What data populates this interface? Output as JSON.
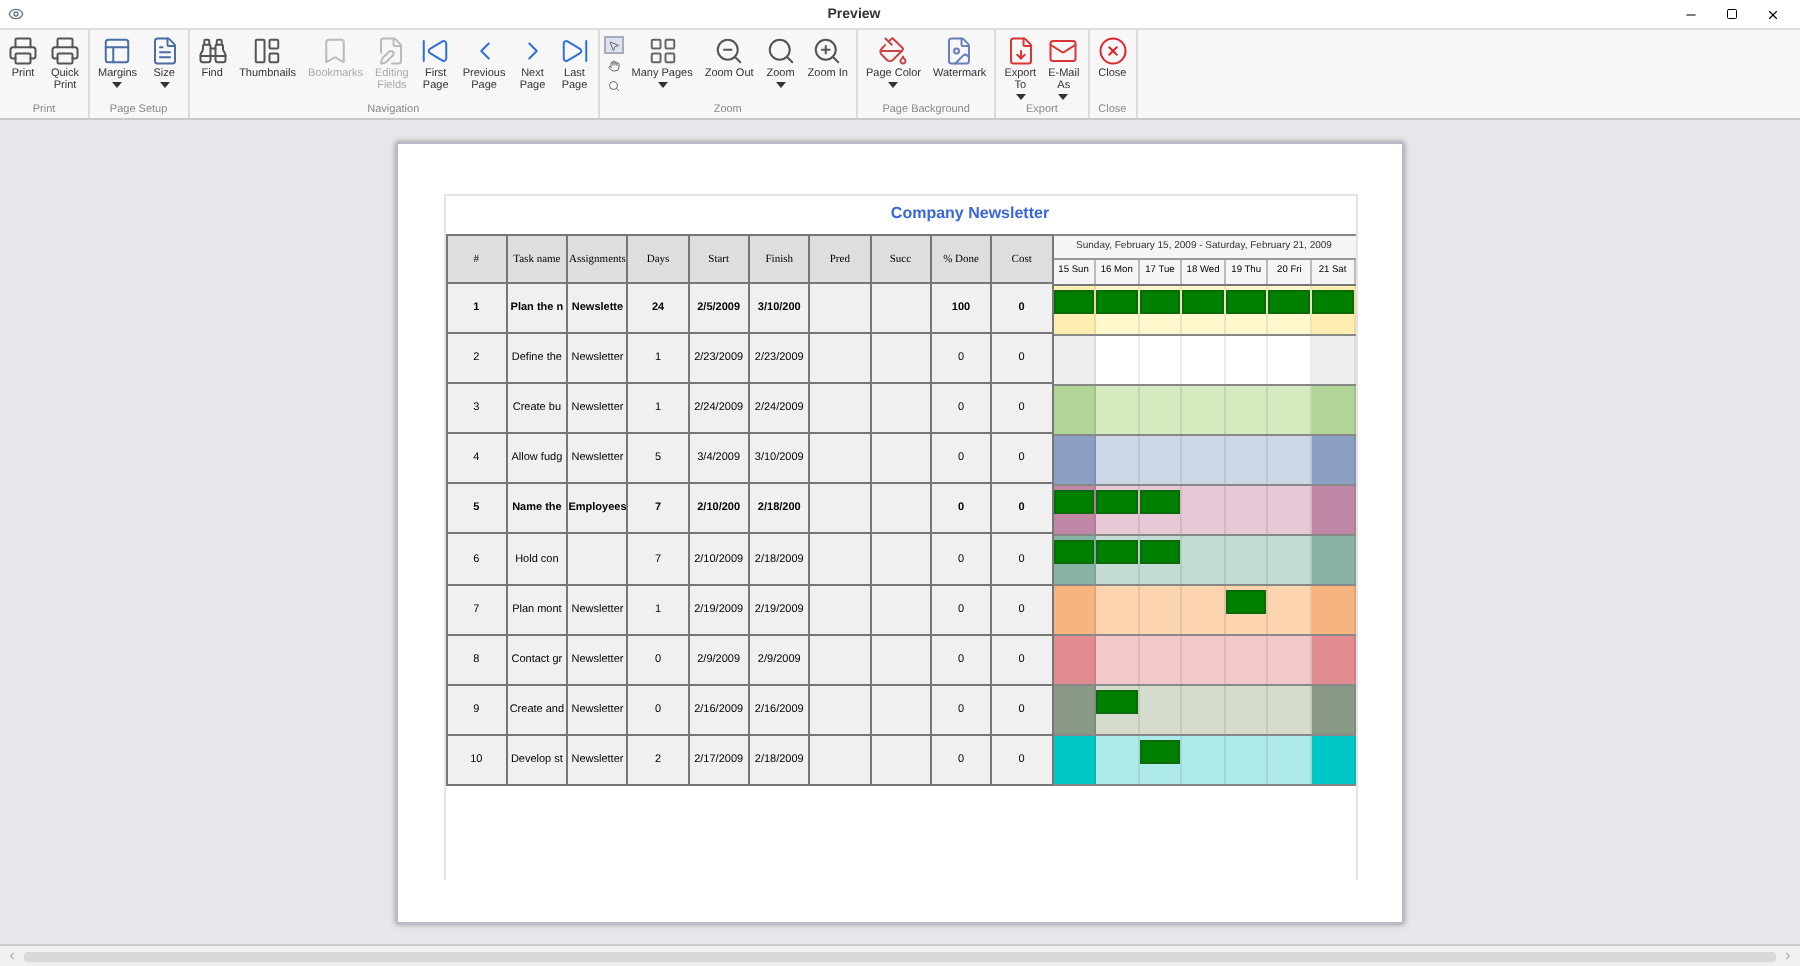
{
  "window": {
    "title": "Preview"
  },
  "ribbon": {
    "groups": [
      {
        "label": "Print",
        "buttons": [
          {
            "label": "Print",
            "disabled": false,
            "dropdown": false
          },
          {
            "label": "Quick\nPrint",
            "disabled": false,
            "dropdown": false
          }
        ]
      },
      {
        "label": "Page Setup",
        "buttons": [
          {
            "label": "Margins",
            "disabled": false,
            "dropdown": true
          },
          {
            "label": "Size",
            "disabled": false,
            "dropdown": true
          }
        ]
      },
      {
        "label": "Navigation",
        "buttons": [
          {
            "label": "Find",
            "disabled": false,
            "dropdown": false
          },
          {
            "label": "Thumbnails",
            "disabled": false,
            "dropdown": false
          },
          {
            "label": "Bookmarks",
            "disabled": true,
            "dropdown": false
          },
          {
            "label": "Editing\nFields",
            "disabled": true,
            "dropdown": false
          },
          {
            "label": "First\nPage",
            "disabled": false,
            "dropdown": false
          },
          {
            "label": "Previous\nPage",
            "disabled": false,
            "dropdown": false
          },
          {
            "label": "Next\nPage",
            "disabled": false,
            "dropdown": false
          },
          {
            "label": "Last\nPage",
            "disabled": false,
            "dropdown": false
          }
        ]
      },
      {
        "label": "Zoom",
        "cursor_tools": [
          {
            "selected": true
          },
          {
            "selected": false
          },
          {
            "selected": false
          }
        ],
        "buttons": [
          {
            "label": "Many Pages",
            "disabled": false,
            "dropdown": true
          },
          {
            "label": "Zoom Out",
            "disabled": false,
            "dropdown": false
          },
          {
            "label": "Zoom",
            "disabled": false,
            "dropdown": true
          },
          {
            "label": "Zoom In",
            "disabled": false,
            "dropdown": false
          }
        ]
      },
      {
        "label": "Page Background",
        "buttons": [
          {
            "label": "Page Color",
            "disabled": false,
            "dropdown": true
          },
          {
            "label": "Watermark",
            "disabled": false,
            "dropdown": false
          }
        ]
      },
      {
        "label": "Export",
        "buttons": [
          {
            "label": "Export\nTo",
            "disabled": false,
            "dropdown": true
          },
          {
            "label": "E-Mail\nAs",
            "disabled": false,
            "dropdown": true
          }
        ]
      },
      {
        "label": "Close",
        "buttons": [
          {
            "label": "Close",
            "disabled": false,
            "dropdown": false
          }
        ]
      }
    ]
  },
  "document": {
    "title": "Company Newsletter",
    "columns": [
      "#",
      "Task name",
      "Assignments",
      "Days",
      "Start",
      "Finish",
      "Pred",
      "Succ",
      "% Done",
      "Cost"
    ],
    "gantt_range": "Sunday, February 15, 2009 - Saturday, February 21, 2009",
    "gantt_days": [
      "15 Sun",
      "16 Mon",
      "17 Tue",
      "18 Wed",
      "19 Thu",
      "20 Fri",
      "21 Sat"
    ],
    "rows": [
      {
        "summary": true,
        "cells": [
          "1",
          "Plan the n",
          "Newslette",
          "24",
          "2/5/2009",
          "3/10/200",
          "",
          "",
          "100",
          "0"
        ],
        "days": [
          {
            "color": "#ffeeb0",
            "bar": true
          },
          {
            "color": "#fff8cc",
            "bar": true
          },
          {
            "color": "#fff8cc",
            "bar": true
          },
          {
            "color": "#fff8cc",
            "bar": true
          },
          {
            "color": "#fff8cc",
            "bar": true
          },
          {
            "color": "#fff8cc",
            "bar": true
          },
          {
            "color": "#ffeeb0",
            "bar": true
          }
        ]
      },
      {
        "summary": false,
        "cells": [
          "2",
          "Define the",
          "Newsletter",
          "1",
          "2/23/2009",
          "2/23/2009",
          "",
          "",
          "0",
          "0"
        ],
        "days": [
          {
            "color": "#efefef",
            "bar": false
          },
          {
            "color": "#ffffff",
            "bar": false
          },
          {
            "color": "#ffffff",
            "bar": false
          },
          {
            "color": "#ffffff",
            "bar": false
          },
          {
            "color": "#ffffff",
            "bar": false
          },
          {
            "color": "#ffffff",
            "bar": false
          },
          {
            "color": "#efefef",
            "bar": false
          }
        ]
      },
      {
        "summary": false,
        "cells": [
          "3",
          "Create bu",
          "Newsletter",
          "1",
          "2/24/2009",
          "2/24/2009",
          "",
          "",
          "0",
          "0"
        ],
        "days": [
          {
            "color": "#b2d498",
            "bar": false
          },
          {
            "color": "#d6eabf",
            "bar": false
          },
          {
            "color": "#d6eabf",
            "bar": false
          },
          {
            "color": "#d6eabf",
            "bar": false
          },
          {
            "color": "#d6eabf",
            "bar": false
          },
          {
            "color": "#d6eabf",
            "bar": false
          },
          {
            "color": "#b2d498",
            "bar": false
          }
        ]
      },
      {
        "summary": false,
        "cells": [
          "4",
          "Allow fudg",
          "Newsletter",
          "5",
          "3/4/2009",
          "3/10/2009",
          "",
          "",
          "0",
          "0"
        ],
        "days": [
          {
            "color": "#8c9ec2",
            "bar": false
          },
          {
            "color": "#ccd6e4",
            "bar": false
          },
          {
            "color": "#ccd6e4",
            "bar": false
          },
          {
            "color": "#ccd6e4",
            "bar": false
          },
          {
            "color": "#ccd6e4",
            "bar": false
          },
          {
            "color": "#ccd6e4",
            "bar": false
          },
          {
            "color": "#8c9ec2",
            "bar": false
          }
        ]
      },
      {
        "summary": true,
        "cells": [
          "5",
          "Name the",
          "Employees",
          "7",
          "2/10/200",
          "2/18/200",
          "",
          "",
          "0",
          "0"
        ],
        "days": [
          {
            "color": "#c088a6",
            "bar": true
          },
          {
            "color": "#e6c8d6",
            "bar": true
          },
          {
            "color": "#e6c8d6",
            "bar": true
          },
          {
            "color": "#e6c8d6",
            "bar": false
          },
          {
            "color": "#e6c8d6",
            "bar": false
          },
          {
            "color": "#e6c8d6",
            "bar": false
          },
          {
            "color": "#c088a6",
            "bar": false
          }
        ]
      },
      {
        "summary": false,
        "cells": [
          "6",
          "Hold con",
          "",
          "7",
          "2/10/2009",
          "2/18/2009",
          "",
          "",
          "0",
          "0"
        ],
        "days": [
          {
            "color": "#88b2a6",
            "bar": true
          },
          {
            "color": "#c4dcd4",
            "bar": true
          },
          {
            "color": "#c4dcd4",
            "bar": true
          },
          {
            "color": "#c4dcd4",
            "bar": false
          },
          {
            "color": "#c4dcd4",
            "bar": false
          },
          {
            "color": "#c4dcd4",
            "bar": false
          },
          {
            "color": "#88b2a6",
            "bar": false
          }
        ]
      },
      {
        "summary": false,
        "cells": [
          "7",
          "Plan mont",
          "Newsletter",
          "1",
          "2/19/2009",
          "2/19/2009",
          "",
          "",
          "0",
          "0"
        ],
        "days": [
          {
            "color": "#f8b47e",
            "bar": false
          },
          {
            "color": "#fcd4b0",
            "bar": false
          },
          {
            "color": "#fcd4b0",
            "bar": false
          },
          {
            "color": "#fcd4b0",
            "bar": false
          },
          {
            "color": "#fcd4b0",
            "bar": true
          },
          {
            "color": "#fcd4b0",
            "bar": false
          },
          {
            "color": "#f8b47e",
            "bar": false
          }
        ]
      },
      {
        "summary": false,
        "cells": [
          "8",
          "Contact gr",
          "Newsletter",
          "0",
          "2/9/2009",
          "2/9/2009",
          "",
          "",
          "0",
          "0"
        ],
        "days": [
          {
            "color": "#e08c90",
            "bar": false
          },
          {
            "color": "#f2c8cb",
            "bar": false
          },
          {
            "color": "#f2c8cb",
            "bar": false
          },
          {
            "color": "#f2c8cb",
            "bar": false
          },
          {
            "color": "#f2c8cb",
            "bar": false
          },
          {
            "color": "#f2c8cb",
            "bar": false
          },
          {
            "color": "#e08c90",
            "bar": false
          }
        ]
      },
      {
        "summary": false,
        "cells": [
          "9",
          "Create and",
          "Newsletter",
          "0",
          "2/16/2009",
          "2/16/2009",
          "",
          "",
          "0",
          "0"
        ],
        "days": [
          {
            "color": "#8a9a86",
            "bar": false
          },
          {
            "color": "#d6dccd",
            "bar": true
          },
          {
            "color": "#d6dccd",
            "bar": false
          },
          {
            "color": "#d6dccd",
            "bar": false
          },
          {
            "color": "#d6dccd",
            "bar": false
          },
          {
            "color": "#d6dccd",
            "bar": false
          },
          {
            "color": "#8a9a86",
            "bar": false
          }
        ]
      },
      {
        "summary": false,
        "cells": [
          "10",
          "Develop st",
          "Newsletter",
          "2",
          "2/17/2009",
          "2/18/2009",
          "",
          "",
          "0",
          "0"
        ],
        "days": [
          {
            "color": "#00c8c8",
            "bar": false
          },
          {
            "color": "#aeeaea",
            "bar": false
          },
          {
            "color": "#aeeaea",
            "bar": true
          },
          {
            "color": "#aeeaea",
            "bar": false
          },
          {
            "color": "#aeeaea",
            "bar": false
          },
          {
            "color": "#aeeaea",
            "bar": false
          },
          {
            "color": "#00c8c8",
            "bar": false
          }
        ]
      }
    ]
  }
}
